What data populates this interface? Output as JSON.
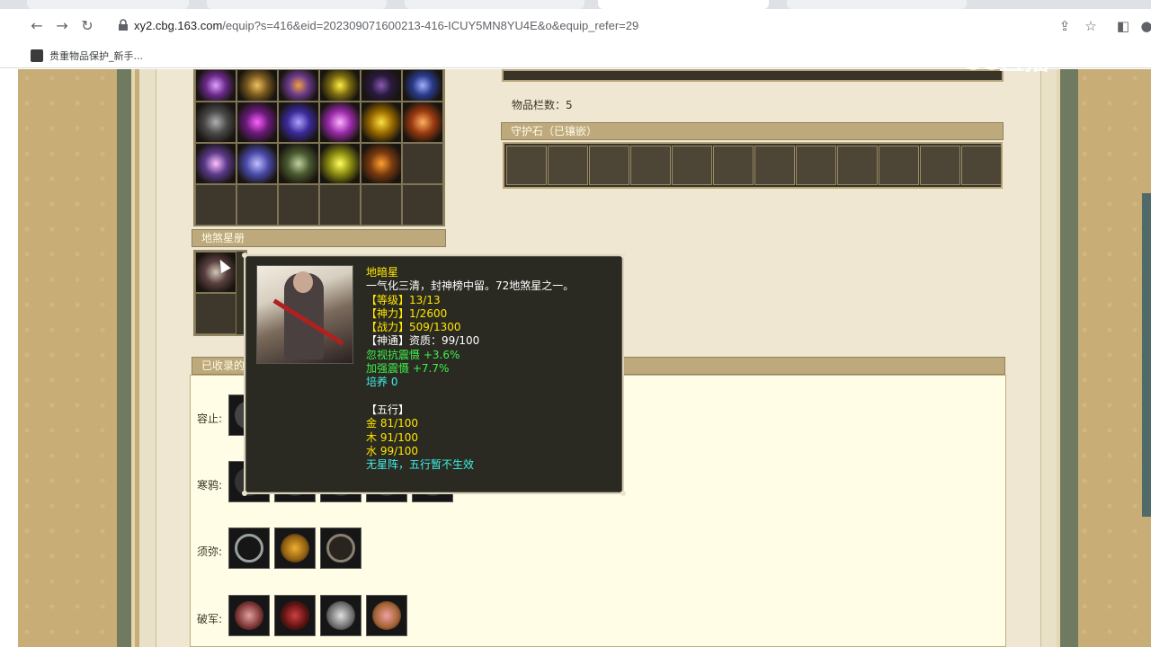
{
  "browser": {
    "url_host": "xy2.cbg.163.com",
    "url_path": "/equip?s=416&eid=202309071600213-416-ICUY5MN8YU4E&o&equip_refer=29",
    "bookmark_label": "贵重物品保护_新手..."
  },
  "watermark": "CC直播",
  "sections": {
    "item_slots_label": "物品栏数：5",
    "guardian_stone_header": "守护石（已镶嵌）",
    "disha_header": "地煞星册",
    "collected_header": "已收录的"
  },
  "collected_rows": [
    {
      "label": "容止:"
    },
    {
      "label": "寒鸦:"
    },
    {
      "label": "须弥:"
    },
    {
      "label": "破军:"
    }
  ],
  "tooltip": {
    "name": "地暗星",
    "desc": "一气化三清，封神榜中留。72地煞星之一。",
    "level": "【等级】13/13",
    "power": "【神力】1/2600",
    "combat": "【战力】509/1300",
    "shentong": "【神通】资质：99/100",
    "bonus1": "忽视抗震慑 +3.6%",
    "bonus2": "加强震慑 +7.7%",
    "nurture": "培养 0",
    "wuxing_title": "【五行】",
    "metal": "金 81/100",
    "wood": "木 91/100",
    "water": "水 99/100",
    "note": "无星阵，五行暂不生效"
  },
  "colors": {
    "tooltip_bg": "#2b2a22",
    "yellow": "#ffe600",
    "green": "#3cf04a",
    "cyan": "#3ef0e6"
  }
}
